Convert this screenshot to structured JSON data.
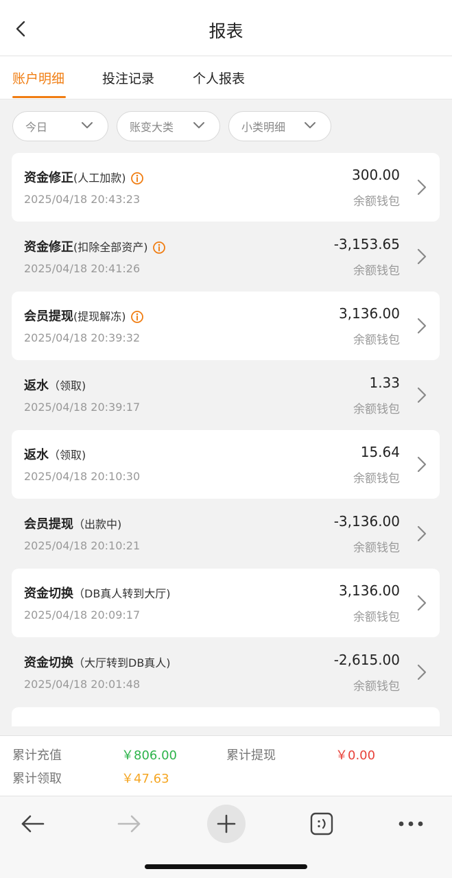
{
  "header": {
    "title": "报表"
  },
  "tabs": [
    {
      "label": "账户明细",
      "active": true
    },
    {
      "label": "投注记录",
      "active": false
    },
    {
      "label": "个人报表",
      "active": false
    }
  ],
  "filters": [
    {
      "label": "今日"
    },
    {
      "label": "账变大类"
    },
    {
      "label": "小类明细"
    }
  ],
  "records": [
    {
      "title": "资金修正",
      "detail": "(人工加款)",
      "has_info_icon": true,
      "time": "2025/04/18 20:43:23",
      "amount": "300.00",
      "wallet": "余额钱包"
    },
    {
      "title": "资金修正",
      "detail": "(扣除全部资产)",
      "has_info_icon": true,
      "time": "2025/04/18 20:41:26",
      "amount": "-3,153.65",
      "wallet": "余额钱包"
    },
    {
      "title": "会员提现",
      "detail": "(提现解冻)",
      "has_info_icon": true,
      "time": "2025/04/18 20:39:32",
      "amount": "3,136.00",
      "wallet": "余额钱包"
    },
    {
      "title": "返水",
      "detail": "（领取)",
      "has_info_icon": false,
      "time": "2025/04/18 20:39:17",
      "amount": "1.33",
      "wallet": "余额钱包"
    },
    {
      "title": "返水",
      "detail": "（领取)",
      "has_info_icon": false,
      "time": "2025/04/18 20:10:30",
      "amount": "15.64",
      "wallet": "余额钱包"
    },
    {
      "title": "会员提现",
      "detail": "（出款中)",
      "has_info_icon": false,
      "time": "2025/04/18 20:10:21",
      "amount": "-3,136.00",
      "wallet": "余额钱包"
    },
    {
      "title": "资金切换",
      "detail": "（DB真人转到大厅)",
      "has_info_icon": false,
      "time": "2025/04/18 20:09:17",
      "amount": "3,136.00",
      "wallet": "余额钱包"
    },
    {
      "title": "资金切换",
      "detail": "（大厅转到DB真人)",
      "has_info_icon": false,
      "time": "2025/04/18 20:01:48",
      "amount": "-2,615.00",
      "wallet": "余额钱包"
    }
  ],
  "summary": {
    "deposit_label": "累计充值",
    "deposit_value": "￥806.00",
    "withdraw_label": "累计提现",
    "withdraw_value": "￥0.00",
    "claim_label": "累计领取",
    "claim_value": "￥47.63"
  },
  "colors": {
    "accent": "#f07d12",
    "deposit": "#2db34a",
    "withdraw": "#e8423a",
    "claim": "#f5a623",
    "info_icon": "#f07d12"
  },
  "browser_toolbar": {
    "icons": [
      "back-arrow-icon",
      "forward-arrow-icon",
      "plus-icon",
      "tabs-smiley-icon",
      "more-dots-icon"
    ]
  }
}
